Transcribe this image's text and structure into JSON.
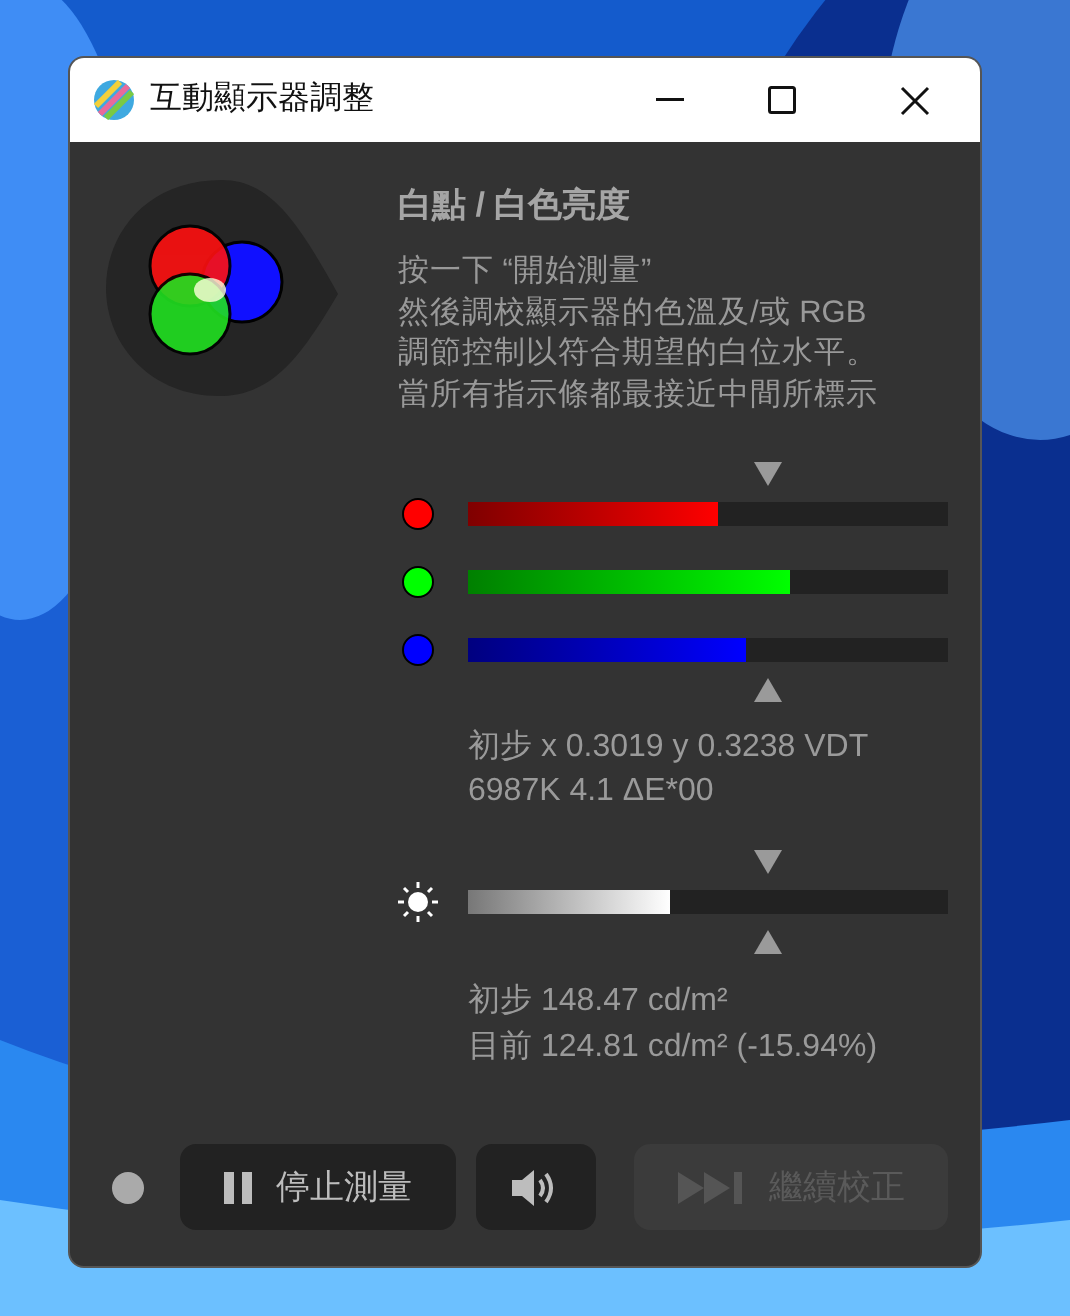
{
  "window": {
    "title": "互動顯示器調整"
  },
  "heading": "白點 / 白色亮度",
  "instructions": [
    "按一下 “開始測量”",
    "然後調校顯示器的色溫及/或 RGB",
    "調節控制以符合期望的白位水平。",
    "當所有指示條都最接近中間所標示"
  ],
  "channels": [
    {
      "color": "#ff0000",
      "level": 0.52
    },
    {
      "color": "#00ff00",
      "level": 0.67
    },
    {
      "color": "#0000ff",
      "level": 0.58
    }
  ],
  "chromaticity": [
    "初步 x 0.3019 y 0.3238 VDT",
    "6987K 4.1 ΔE*00"
  ],
  "brightness": {
    "level": 0.42
  },
  "luminance": [
    "初步 148.47 cd/m²",
    "目前 124.81 cd/m² (-15.94%)"
  ],
  "buttons": [
    {
      "kind": "pause",
      "label": "停止測量",
      "disabled": false
    },
    {
      "kind": "sound",
      "disabled": false
    },
    {
      "kind": "skip",
      "label": "繼續校正",
      "disabled": true
    }
  ]
}
